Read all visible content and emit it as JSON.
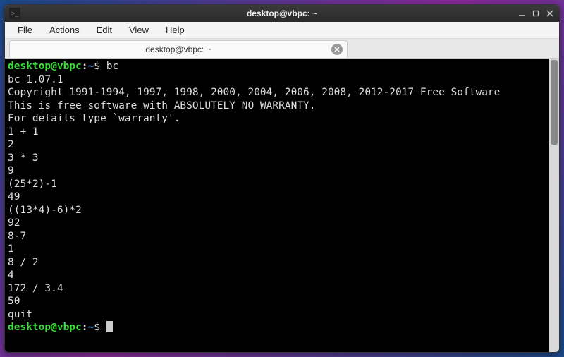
{
  "window": {
    "title": "desktop@vbpc: ~"
  },
  "menu": {
    "file": "File",
    "actions": "Actions",
    "edit": "Edit",
    "view": "View",
    "help": "Help"
  },
  "tab": {
    "title": "desktop@vbpc: ~"
  },
  "prompt": {
    "userhost": "desktop@vbpc",
    "colon": ":",
    "path": "~",
    "dollar": "$"
  },
  "terminal": {
    "lines": [
      {
        "type": "prompt",
        "cmd": "bc"
      },
      {
        "type": "out",
        "text": "bc 1.07.1"
      },
      {
        "type": "out",
        "text": "Copyright 1991-1994, 1997, 1998, 2000, 2004, 2006, 2008, 2012-2017 Free Software"
      },
      {
        "type": "out",
        "text": "This is free software with ABSOLUTELY NO WARRANTY."
      },
      {
        "type": "out",
        "text": "For details type `warranty'."
      },
      {
        "type": "out",
        "text": "1 + 1"
      },
      {
        "type": "out",
        "text": "2"
      },
      {
        "type": "out",
        "text": "3 * 3"
      },
      {
        "type": "out",
        "text": "9"
      },
      {
        "type": "out",
        "text": "(25*2)-1"
      },
      {
        "type": "out",
        "text": "49"
      },
      {
        "type": "out",
        "text": "((13*4)-6)*2"
      },
      {
        "type": "out",
        "text": "92"
      },
      {
        "type": "out",
        "text": "8-7"
      },
      {
        "type": "out",
        "text": "1"
      },
      {
        "type": "out",
        "text": "8 / 2"
      },
      {
        "type": "out",
        "text": "4"
      },
      {
        "type": "out",
        "text": "172 / 3.4"
      },
      {
        "type": "out",
        "text": "50"
      },
      {
        "type": "out",
        "text": "quit"
      },
      {
        "type": "prompt",
        "cmd": ""
      }
    ]
  }
}
